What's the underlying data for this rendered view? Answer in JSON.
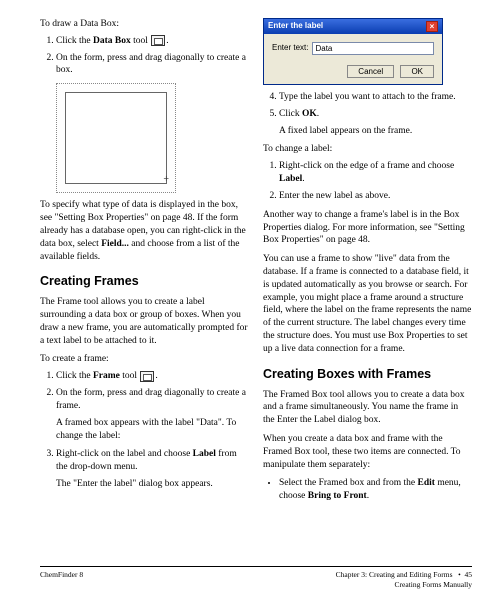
{
  "left": {
    "intro1": "To draw a Data Box:",
    "step1a": "Click the ",
    "step1b": "Data Box",
    "step1c": " tool ",
    "step1d": ".",
    "step2": "On the form, press and drag diagonally to create a box.",
    "para1": "To specify what type of data is displayed in the box, see \"Setting Box Properties\" on page 48. If the form already has a database open, you can right-click in the data box, select ",
    "para1b": "Field...",
    "para1c": " and choose from a list of the available fields.",
    "h1": "Creating Frames",
    "para2": "The Frame tool allows you to create a label surrounding a data box or group of boxes. When you draw a new frame, you are automatically prompted for a text label to be attached to it.",
    "intro2": "To create a frame:",
    "fstep1a": "Click the ",
    "fstep1b": "Frame",
    "fstep1c": " tool ",
    "fstep1d": ".",
    "fstep2": "On the form, press and drag diagonally to create a frame.",
    "findent1": "A framed box appears with the label \"Data\". To change the label:",
    "fstep3a": "Right-click on the label and choose ",
    "fstep3b": "Label",
    "fstep3c": " from the drop-down menu.",
    "findent2": "The \"Enter the label\" dialog box appears."
  },
  "dialog": {
    "title": "Enter the label",
    "label": "Enter text:",
    "value": "Data",
    "cancel": "Cancel",
    "ok": "OK"
  },
  "right": {
    "step4": "Type the label you want to attach to the frame.",
    "step5a": "Click ",
    "step5b": "OK",
    "step5c": ".",
    "indent5": "A fixed label appears on the frame.",
    "intro3": "To change a label:",
    "cstep1a": "Right-click on the edge of a frame and choose ",
    "cstep1b": "Label",
    "cstep1c": ".",
    "cstep2": "Enter the new label as above.",
    "para3": "Another way to change a frame's label is in the Box Properties dialog. For more information, see \"Setting Box Properties\" on page 48.",
    "para4": "You can use a frame to show \"live\" data from the database. If a frame is connected to a database field, it is updated automatically as you browse or search. For example, you might place a frame around a structure field, where the label on the frame represents the name of the current structure. The label changes every time the structure does. You must use Box Properties to set up a live data connection for a frame.",
    "h2": "Creating Boxes with Frames",
    "para5": "The Framed Box tool allows you to create a data box and a frame simultaneously. You name the frame in the Enter the Label dialog box.",
    "para6": "When you create a data box and frame with the Framed Box tool, these two items are connected. To manipulate them separately:",
    "bul1a": "Select the Framed box and from the ",
    "bul1b": "Edit",
    "bul1c": " menu, choose ",
    "bul1d": "Bring to Front",
    "bul1e": "."
  },
  "footer": {
    "left": "ChemFinder 8",
    "right1": "Chapter 3: Creating and Editing Forms",
    "right2": "Creating Forms Manually",
    "page": "45",
    "bullet": "•"
  }
}
